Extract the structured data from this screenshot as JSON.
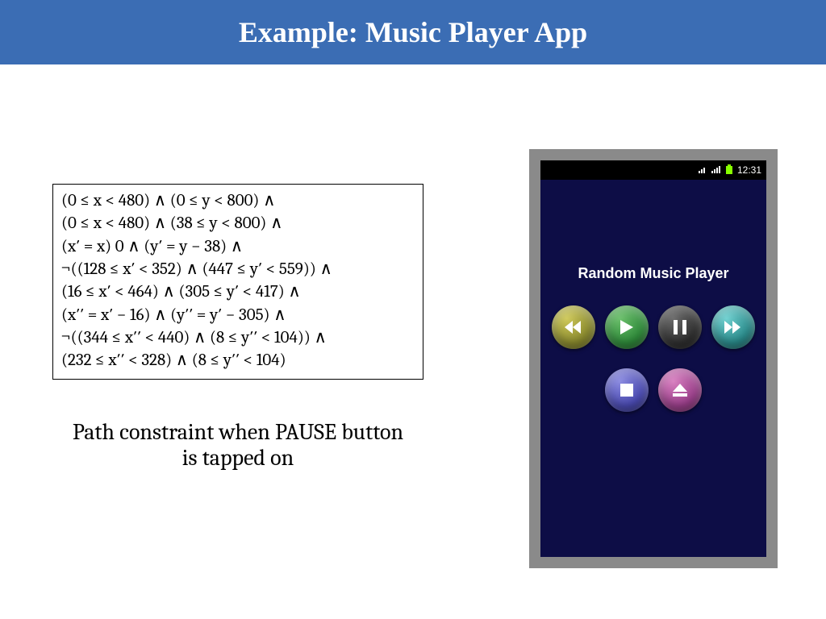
{
  "title": "Example: Music Player App",
  "constraints": [
    "(0  ≤ x < 480)  ∧ (0  ≤ y < 800) ∧",
    "(0  ≤ x < 480)  ∧  (38  ≤ y < 800) ∧",
    "(x′ = x) 0  ∧ (y′ = y − 38) ∧",
    "¬((128  ≤ x′ < 352)  ∧  (447  ≤ y′ < 559)) ∧",
    "(16  ≤ x′ < 464)  ∧  (305  ≤ y′ < 417) ∧",
    "(x′′ = x′ − 16)  ∧ (y′′ = y′ − 305) ∧",
    "¬((344  ≤ x′′ < 440)  ∧ (8 ≤ y′′ < 104)) ∧",
    "(232  ≤ x′′ < 328)  ∧ (8 ≤ y′′ < 104)"
  ],
  "caption": "Path constraint when PAUSE button is tapped on",
  "phone": {
    "time": "12:31",
    "app_title": "Random Music Player",
    "buttons": {
      "rewind": "rewind",
      "play": "play",
      "pause": "pause",
      "forward": "forward",
      "stop": "stop",
      "eject": "eject"
    }
  }
}
